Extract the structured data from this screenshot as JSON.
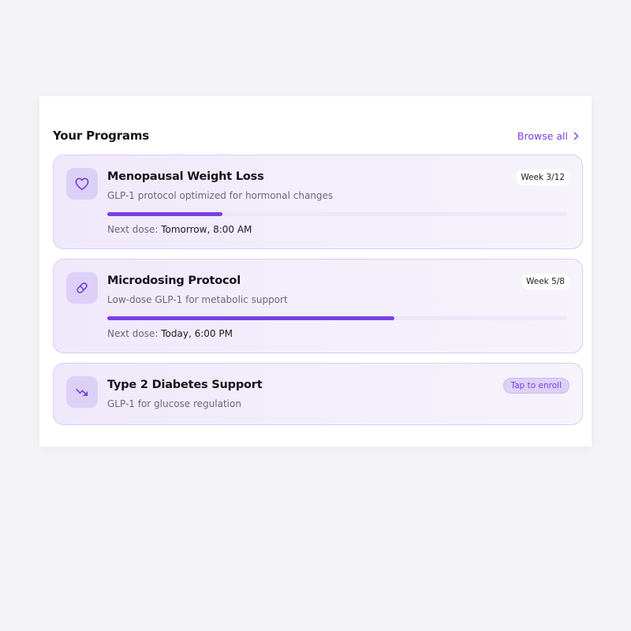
{
  "header": {
    "title": "Your Programs",
    "browse_label": "Browse all",
    "browse_icon": "chevron-right-icon"
  },
  "accent_color": "#7b3fe4",
  "programs": [
    {
      "icon": "heart-icon",
      "title": "Menopausal Weight Loss",
      "subtitle": "GLP-1 protocol optimized for hormonal changes",
      "badge": "Week 3/12",
      "progress": 0.25,
      "next_dose_label": "Next dose:",
      "next_dose_value": "Tomorrow, 8:00 AM"
    },
    {
      "icon": "pill-icon",
      "title": "Microdosing Protocol",
      "subtitle": "Low-dose GLP-1 for metabolic support",
      "badge": "Week 5/8",
      "progress": 0.625,
      "next_dose_label": "Next dose:",
      "next_dose_value": "Today, 6:00 PM"
    },
    {
      "icon": "trending-down-icon",
      "title": "Type 2 Diabetes Support",
      "subtitle": "GLP-1 for glucose regulation",
      "badge": "Tap to enroll"
    }
  ]
}
